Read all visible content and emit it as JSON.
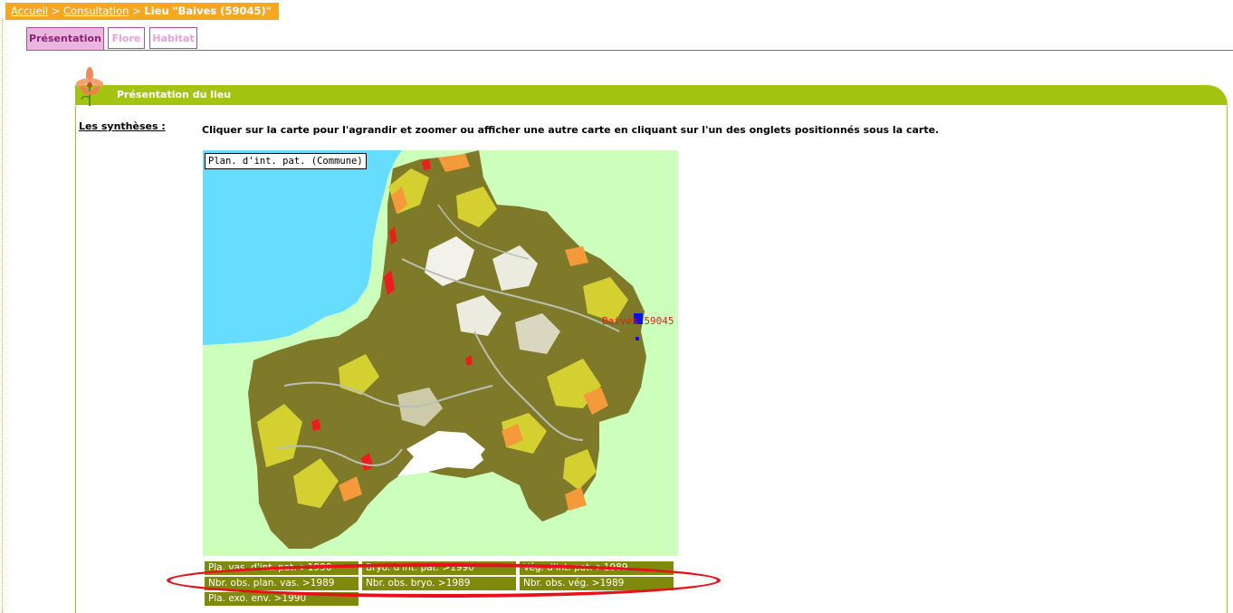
{
  "breadcrumb": {
    "home": "Accueil",
    "sep1": " > ",
    "consultation": "Consultation",
    "sep2": " > ",
    "current": "Lieu \"Baives (59045)\""
  },
  "tabs": [
    {
      "label": "Présentation",
      "active": true
    },
    {
      "label": "Flore",
      "active": false
    },
    {
      "label": "Habitat",
      "active": false
    }
  ],
  "section": {
    "title": "Présentation du lieu",
    "syntheses_label": "Les synthèses :",
    "instruction": "Cliquer sur la carte pour l'agrandir et zoomer ou afficher une autre carte en cliquant sur l'un des onglets positionnés sous la carte."
  },
  "map": {
    "legend_label": "Plan. d'int. pat. (Commune)",
    "marker_label": "Baives 59045",
    "colors": {
      "background": "#ccffbb",
      "sea": "#66ddff",
      "commune_dark": "#7f7a2a",
      "commune_yellow": "#d4d032",
      "commune_orange": "#f59a3a",
      "commune_red": "#ee1c1c",
      "marker": "#1010e0"
    }
  },
  "layers": {
    "row1": [
      "Pla. vas. d'int. pat. >1990",
      "Bryo. d'int. pat. >1990",
      "Vég. d'int. pat. >1989"
    ],
    "row2": [
      "Nbr. obs. plan. vas. >1989",
      "Nbr. obs. bryo. >1989",
      "Nbr. obs. vég. >1989"
    ],
    "row3": [
      "Pla. exo. env. >1990"
    ]
  },
  "colors": {
    "breadcrumb_bg": "#f5a623",
    "tab_active_bg": "#e9b6df",
    "tab_border": "#b04f97",
    "section_green": "#a3c512",
    "layer_button_bg": "#7f8a0c",
    "highlight_red": "#e8101a"
  }
}
